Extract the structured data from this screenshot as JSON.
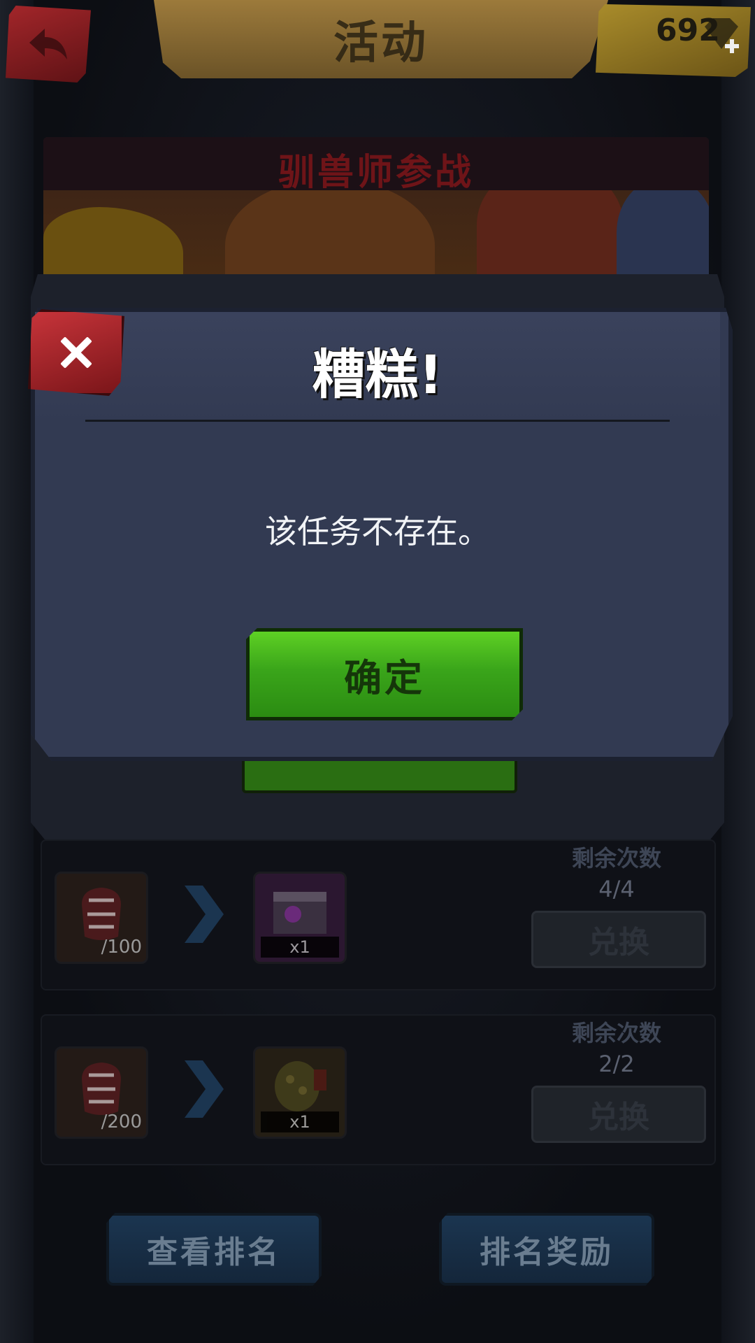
{
  "header": {
    "title": "活动",
    "gems": "692"
  },
  "banner": {
    "title": "驯兽师参战"
  },
  "exchange_rows": [
    {
      "cost": "/100",
      "reward_qty": "x1",
      "remaining_label": "剩余次数",
      "remaining_value": "4/4",
      "button": "兑换"
    },
    {
      "cost": "/200",
      "reward_qty": "x1",
      "remaining_label": "剩余次数",
      "remaining_value": "2/2",
      "button": "兑换"
    }
  ],
  "bottom": {
    "ranking_button": "查看排名",
    "reward_button": "排名奖励"
  },
  "dialog": {
    "title": "糟糕!",
    "message": "该任务不存在。",
    "confirm_button": "确定"
  },
  "colors": {
    "dialog_bg": "#323a52",
    "confirm_green": "#3aa51a",
    "close_red": "#c7343a"
  },
  "icons": [
    "back-arrow-icon",
    "gem-icon",
    "plus-icon",
    "close-x-icon",
    "chevron-right-icon",
    "gauntlet-icon",
    "chest-icon",
    "shell-armor-icon"
  ]
}
